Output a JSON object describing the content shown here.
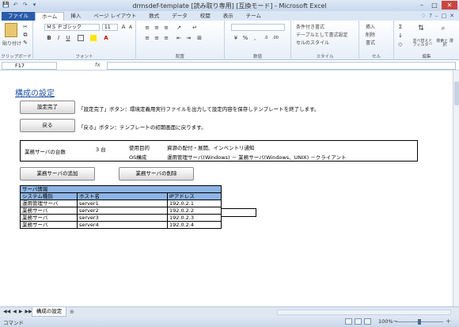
{
  "window": {
    "title": "drmsdef-template [読み取り専用] [互換モード] - Microsoft Excel",
    "qat": [
      "💾",
      "↶",
      "↷",
      "▾"
    ],
    "controls": [
      "–",
      "□",
      "✕"
    ]
  },
  "ribbon": {
    "tabs": [
      "ファイル",
      "ホーム",
      "挿入",
      "ページ レイアウト",
      "数式",
      "データ",
      "校閲",
      "表示",
      "チーム"
    ],
    "help": [
      "♢",
      "?",
      "–",
      "□",
      "✕"
    ],
    "groups": {
      "clipboard": {
        "label": "クリップボード",
        "paste": "貼り付け"
      },
      "font": {
        "label": "フォント",
        "font_name": "ＭＳ Ｐゴシック",
        "font_size": "11",
        "grow": "A",
        "shrink": "A",
        "bold": "B",
        "italic": "I",
        "underline": "U"
      },
      "alignment": {
        "label": "配置"
      },
      "number": {
        "label": "数値",
        "format": "",
        "percent": "%",
        "comma": ","
      },
      "styles": {
        "label": "スタイル",
        "cond": "条件付き書式",
        "table": "テーブルとして書式設定",
        "cell": "セルのスタイル"
      },
      "cells": {
        "label": "セル",
        "insert": "挿入",
        "delete": "削除",
        "format": "書式"
      },
      "editing": {
        "label": "編集",
        "sum": "Σ",
        "sort": "並べ替えと フィルター",
        "find": "検索と 選択"
      }
    }
  },
  "formula_bar": {
    "name_box": "F17",
    "fx": "fx",
    "content": ""
  },
  "sheet": {
    "heading": "構成の設定",
    "buttons": {
      "complete": "設定完了",
      "back": "戻る",
      "add": "業務サーバの追加",
      "remove": "業務サーバの削除"
    },
    "desc_complete": "「設定完了」ボタン：環境定義用実行ファイルを出力して設定内容を保存しテンプレートを終了します。",
    "desc_back": "「戻る」ボタン：テンプレートの初期画面に戻ります。",
    "info": {
      "server_count_label": "業務サーバの台数",
      "server_count": "3 台",
      "purpose_label": "使用目的",
      "purpose": "資源の配付・展開、インベントリ通知",
      "os_label": "OS構成",
      "os": "運用管理サーバ(Windows) － 業務サーバ(Windows、UNIX) －クライアント"
    },
    "server_table": {
      "title": "サーバ情報",
      "headers": [
        "システム種別",
        "ホスト名",
        "IPアドレス"
      ],
      "rows": [
        [
          "運用管理サーバ",
          "server1",
          "192.0.2.1"
        ],
        [
          "業務サーバ",
          "server2",
          "192.0.2.2"
        ],
        [
          "業務サーバ",
          "server3",
          "192.0.2.3"
        ],
        [
          "業務サーバ",
          "server4",
          "192.0.2.4"
        ]
      ]
    }
  },
  "sheet_tabs": {
    "nav": [
      "◀◀",
      "◀",
      "▶",
      "▶▶"
    ],
    "active": "構成の設定"
  },
  "status": {
    "mode": "コマンド",
    "zoom": "100%",
    "minus": "－",
    "plus": "＋"
  }
}
